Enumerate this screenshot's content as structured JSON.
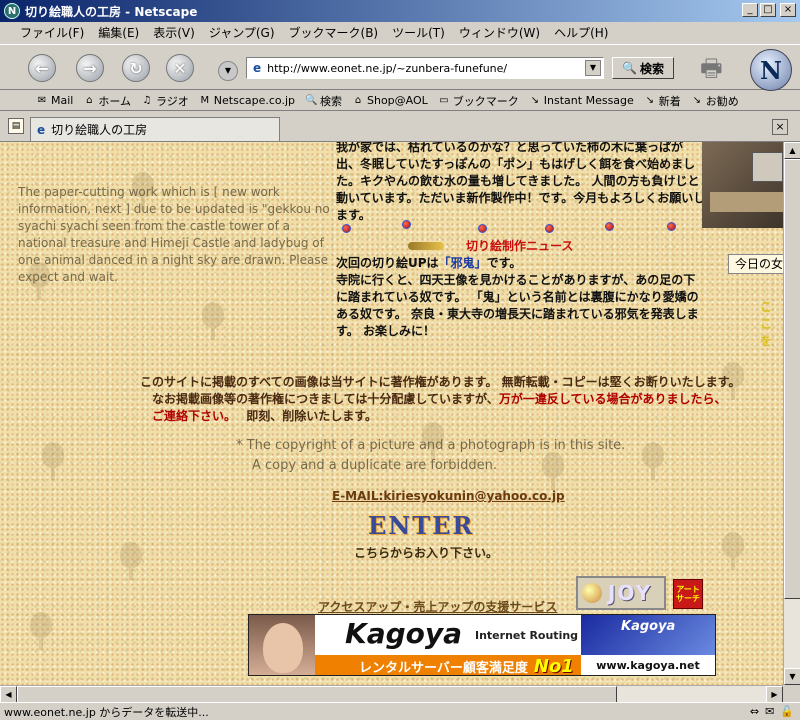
{
  "window": {
    "title": "切り絵職人の工房 - Netscape",
    "app_icon": "netscape-n-icon",
    "buttons": [
      "minimize",
      "maximize",
      "close"
    ]
  },
  "menubar": {
    "items": [
      "ファイル(F)",
      "編集(E)",
      "表示(V)",
      "ジャンプ(G)",
      "ブックマーク(B)",
      "ツール(T)",
      "ウィンドウ(W)",
      "ヘルプ(H)"
    ]
  },
  "navbar": {
    "url": "http://www.eonet.ne.jp/~zunbera-funefune/",
    "search_label": "検索"
  },
  "personal_toolbar": {
    "items": [
      {
        "label": "Mail",
        "icon": "mail-icon"
      },
      {
        "label": "ホーム",
        "icon": "home-icon"
      },
      {
        "label": "ラジオ",
        "icon": "headphones-icon"
      },
      {
        "label": "Netscape.co.jp",
        "icon": "my-icon"
      },
      {
        "label": "検索",
        "icon": "search-icon"
      },
      {
        "label": "Shop@AOL",
        "icon": "shop-icon"
      },
      {
        "label": "ブックマーク",
        "icon": "folder-icon"
      },
      {
        "label": "Instant Message",
        "icon": "bookmark-icon"
      },
      {
        "label": "新着",
        "icon": "bookmark-icon"
      },
      {
        "label": "お勧め",
        "icon": "bookmark-icon"
      }
    ]
  },
  "tab": {
    "label": "切り絵職人の工房"
  },
  "page": {
    "english_notice": "The paper-cutting work which is [ new work information, next ] due to be updated is \"gekkou no syachi syachi seen from the castle tower of a national treasure and Himeji Castle and ladybug of one animal danced in a night sky are drawn. Please expect and wait.",
    "news_top": "我が家では、枯れているのかな？と思っていた柿の木に葉っぱが出、冬眠していたすっぽんの「ポン」もはげしく餌を食べ始めました。キクやんの飲む水の量も増してきました。 人間の方も負けじと動いています。ただいま新作製作中！です。今月もよろしくお願いします。",
    "news_title": "切り絵制作ニュース",
    "news_line1_a": "次回の切り絵UPは",
    "news_line1_tag": "「邪鬼」",
    "news_line1_b": "です。",
    "news_body": "寺院に行くと、四天王像を見かけることがありますが、あの足の下に踏まれている奴です。 「鬼」という名前とは裏腹にかなり愛嬌のある奴です。 奈良・東大寺の増長天に踏まれている邪気を発表します。 お楽しみに！",
    "today_label": "今日の女",
    "side_text": "ここを",
    "copyright_jp_line1": "このサイトに掲載のすべての画像は当サイトに著作権があります。 無断転載・コピーは堅くお断りいたします。",
    "copyright_jp_line2_a": "なお掲載画像等の著作権につきましては十分配慮していますが、",
    "copyright_jp_line2_red": "万が一違反している場合がありましたら、",
    "copyright_jp_line3_red": "ご連絡下さい。",
    "copyright_jp_line3_b": "　 即刻、削除いたします。",
    "copyright_en_line1": "* The copyright of a picture and a photograph is in this site.",
    "copyright_en_line2": "A copy and a duplicate are forbidden.",
    "email": "E-MAIL:kiriesyokunin@yahoo.co.jp",
    "enter_logo": "ENTER",
    "enter_text": "こちらからお入り下さい。",
    "access_text": "アクセスアップ・売上アップの支援サービス",
    "joy_banner": "JOY",
    "art_banner_line1": "アート",
    "art_banner_line2": "サーチ",
    "kagoya": {
      "title": "Kagoya",
      "subtitle": "Internet Routing",
      "bar_text": "レンタルサーバー顧客満足度",
      "no1": "No1",
      "side_logo": "Kagoya",
      "url": "www.kagoya.net"
    }
  },
  "status": {
    "text": "www.eonet.ne.jp からデータを転送中..."
  }
}
